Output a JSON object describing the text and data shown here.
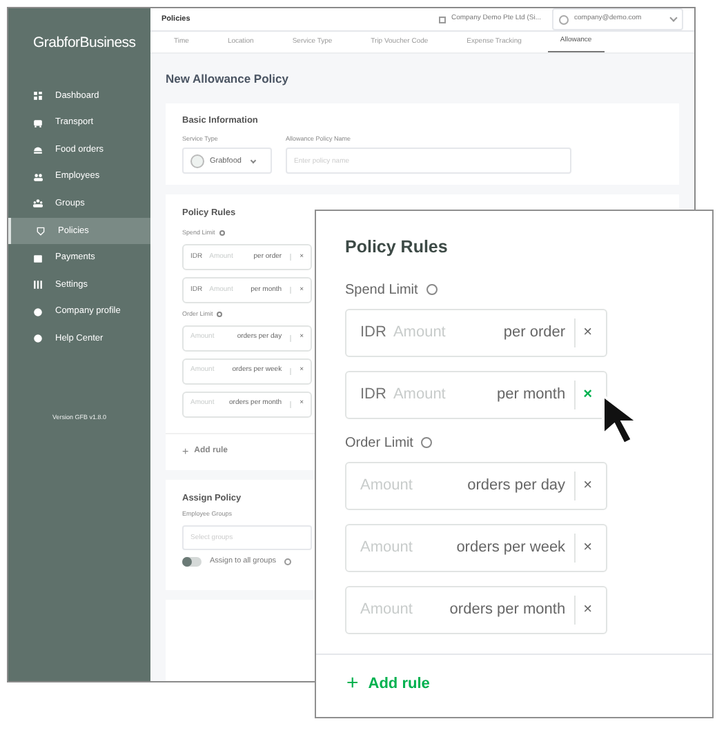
{
  "sidebar": {
    "logo": "GrabforBusiness",
    "items": [
      {
        "label": "Dashboard",
        "selected": false
      },
      {
        "label": "Transport",
        "selected": false
      },
      {
        "label": "Food orders",
        "selected": false
      },
      {
        "label": "Employees",
        "selected": false
      },
      {
        "label": "Groups",
        "selected": false
      },
      {
        "label": "Policies",
        "selected": true
      },
      {
        "label": "Payments",
        "selected": false
      },
      {
        "label": "Settings",
        "selected": false
      },
      {
        "label": "Company profile",
        "selected": false
      },
      {
        "label": "Help Center",
        "selected": false
      }
    ],
    "version": "Version GFB v1.8.0"
  },
  "header": {
    "breadcrumb": "Policies",
    "company": "Company Demo Pte Ltd (Si...",
    "account": "company@demo.com"
  },
  "tabs": [
    {
      "label": "Time",
      "selected": false
    },
    {
      "label": "Location",
      "selected": false
    },
    {
      "label": "Service Type",
      "selected": false
    },
    {
      "label": "Trip Voucher Code",
      "selected": false
    },
    {
      "label": "Expense Tracking",
      "selected": false
    },
    {
      "label": "Allowance",
      "selected": true
    }
  ],
  "title": "New Allowance Policy",
  "basic_information": {
    "heading": "Basic Information",
    "service_type_label": "Service Type",
    "service_type": "Grabfood",
    "name_label": "Allowance Policy Name",
    "name_placeholder": "Enter policy name"
  },
  "policy_rules": {
    "heading": "Policy Rules",
    "spend_label": "Spend Limit",
    "spend_rows": [
      {
        "currency": "IDR",
        "placeholder": "Amount",
        "unit": "per order",
        "remove": "×"
      },
      {
        "currency": "IDR",
        "placeholder": "Amount",
        "unit": "per month",
        "remove": "×"
      }
    ],
    "order_label": "Order Limit",
    "order_rows": [
      {
        "placeholder": "Amount",
        "unit": "orders per day",
        "remove": "×"
      },
      {
        "placeholder": "Amount",
        "unit": "orders per week",
        "remove": "×"
      },
      {
        "placeholder": "Amount",
        "unit": "orders per month",
        "remove": "×"
      }
    ],
    "add": "+",
    "add_label": "Add rule"
  },
  "assign_policy": {
    "heading": "Assign Policy",
    "groups_label": "Employee Groups",
    "groups_placeholder": "Select groups",
    "assign_all": {
      "label": "Assign to all groups",
      "on": false
    }
  },
  "zoom_callout": {
    "heading": "Policy Rules",
    "spend_label": "Spend Limit",
    "spend_rows": [
      {
        "currency": "IDR",
        "placeholder": "Amount",
        "unit": "per order",
        "remove": "×",
        "highlighted": false
      },
      {
        "currency": "IDR",
        "placeholder": "Amount",
        "unit": "per month",
        "remove": "×",
        "highlighted": true
      }
    ],
    "order_label": "Order Limit",
    "order_rows": [
      {
        "placeholder": "Amount",
        "unit": "orders per day",
        "remove": "×",
        "highlighted": false
      },
      {
        "placeholder": "Amount",
        "unit": "orders per week",
        "remove": "×",
        "highlighted": false
      },
      {
        "placeholder": "Amount",
        "unit": "orders per month",
        "remove": "×",
        "highlighted": false
      }
    ],
    "add": "+",
    "add_label": "Add rule"
  }
}
